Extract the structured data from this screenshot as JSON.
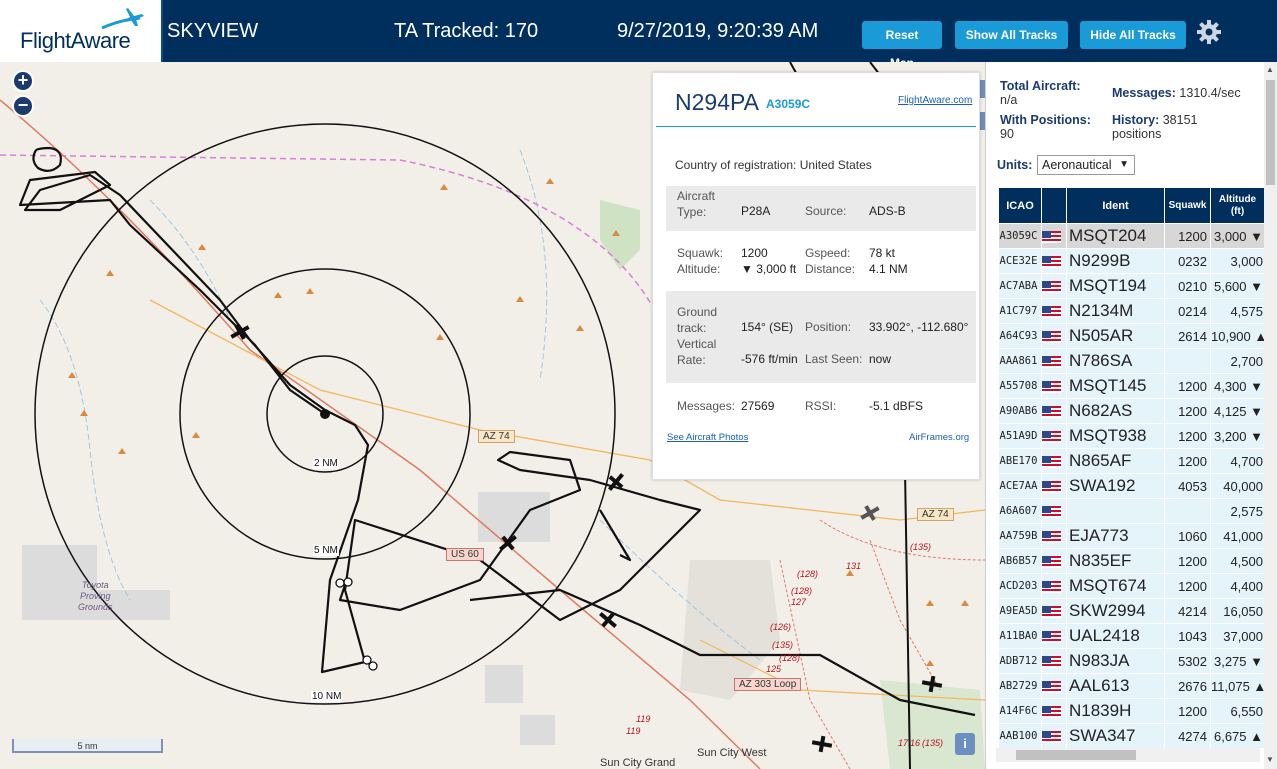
{
  "header": {
    "logo_text": "FlightAware",
    "app_name": "SKYVIEW",
    "tracked": "TA Tracked: 170",
    "datetime": "9/27/2019, 9:20:39 AM",
    "reset_label": "Reset Map",
    "show_label": "Show All Tracks",
    "hide_label": "Hide All Tracks"
  },
  "map": {
    "zoom_in": "+",
    "zoom_out": "−",
    "scale_label": "5 nm",
    "range_labels": [
      "2 NM",
      "5 NM",
      "10 NM"
    ],
    "road_labels": [
      "AZ 74",
      "AZ 74",
      "US 60",
      "AZ 303 Loop"
    ],
    "place_labels": [
      "Toyota",
      "Proving",
      "Grounds",
      "Sun City West",
      "Sun City Grand"
    ],
    "small_labels": [
      "(135)",
      "131",
      "(128)",
      "(128)",
      "127",
      "(126)",
      "125",
      "(135)",
      "119",
      "119",
      "17",
      "16",
      "(135)",
      "(128)"
    ],
    "info_label": "i"
  },
  "popup": {
    "registration": "N294PA",
    "icao": "A3059C",
    "fa_link": "FlightAware.com",
    "country_label": "Country of registration:",
    "country_value": "United States",
    "aircraft_type_label": "Aircraft\nType:",
    "aircraft_type_value": "P28A",
    "source_label": "Source:",
    "source_value": "ADS-B",
    "squawk_label": "Squawk:",
    "squawk_value": "1200",
    "altitude_label": "Altitude:",
    "altitude_value": "▼ 3,000 ft",
    "gspeed_label": "Gspeed:",
    "gspeed_value": "78 kt",
    "distance_label": "Distance:",
    "distance_value": "4.1 NM",
    "ground_track_label": "Ground\ntrack:",
    "ground_track_value": "154° (SE)",
    "position_label": "Position:",
    "position_value": "33.902°, -112.680°",
    "vertical_rate_label": "Vertical\nRate:",
    "vertical_rate_value": "-576 ft/min",
    "last_seen_label": "Last Seen:",
    "last_seen_value": "now",
    "messages_label": "Messages:",
    "messages_value": "27569",
    "rssi_label": "RSSI:",
    "rssi_value": "-5.1 dBFS",
    "photos_link": "See Aircraft Photos",
    "airframes_link": "AirFrames.org"
  },
  "sidebar": {
    "total_label": "Total Aircraft:",
    "total_value": "n/a",
    "positions_label": "With Positions:",
    "positions_value": "90",
    "messages_label": "Messages:",
    "messages_value": "1310.4/sec",
    "history_label": "History:",
    "history_value": "38151",
    "history_unit": "positions",
    "units_label": "Units:",
    "units_value": "Aeronautical",
    "columns": [
      "ICAO",
      "",
      "Ident",
      "Squawk",
      "Altitude (ft)"
    ],
    "rows": [
      {
        "icao": "A3059C",
        "ident": "MSQT204",
        "squawk": "1200",
        "alt": "3,000 ▼"
      },
      {
        "icao": "ACE32E",
        "ident": "N9299B",
        "squawk": "0232",
        "alt": "3,000"
      },
      {
        "icao": "AC7ABA",
        "ident": "MSQT194",
        "squawk": "0210",
        "alt": "5,600 ▼"
      },
      {
        "icao": "A1C797",
        "ident": "N2134M",
        "squawk": "0214",
        "alt": "4,575"
      },
      {
        "icao": "A64C93",
        "ident": "N505AR",
        "squawk": "2614",
        "alt": "10,900 ▲"
      },
      {
        "icao": "AAA861",
        "ident": "N786SA",
        "squawk": "",
        "alt": "2,700"
      },
      {
        "icao": "A55708",
        "ident": "MSQT145",
        "squawk": "1200",
        "alt": "4,300 ▼"
      },
      {
        "icao": "A90AB6",
        "ident": "N682AS",
        "squawk": "1200",
        "alt": "4,125 ▼"
      },
      {
        "icao": "A51A9D",
        "ident": "MSQT938",
        "squawk": "1200",
        "alt": "3,200 ▼"
      },
      {
        "icao": "ABE170",
        "ident": "N865AF",
        "squawk": "1200",
        "alt": "4,700"
      },
      {
        "icao": "ACE7AA",
        "ident": "SWA192",
        "squawk": "4053",
        "alt": "40,000"
      },
      {
        "icao": "A6A607",
        "ident": "",
        "squawk": "",
        "alt": "2,575"
      },
      {
        "icao": "AA759B",
        "ident": "EJA773",
        "squawk": "1060",
        "alt": "41,000"
      },
      {
        "icao": "AB6B57",
        "ident": "N835EF",
        "squawk": "1200",
        "alt": "4,500"
      },
      {
        "icao": "ACD203",
        "ident": "MSQT674",
        "squawk": "1200",
        "alt": "4,400"
      },
      {
        "icao": "A9EA5D",
        "ident": "SKW2994",
        "squawk": "4214",
        "alt": "16,050"
      },
      {
        "icao": "A11BA0",
        "ident": "UAL2418",
        "squawk": "1043",
        "alt": "37,000"
      },
      {
        "icao": "ADB712",
        "ident": "N983JA",
        "squawk": "5302",
        "alt": "3,275 ▼"
      },
      {
        "icao": "AB2729",
        "ident": "AAL613",
        "squawk": "2676",
        "alt": "11,075 ▲"
      },
      {
        "icao": "A14F6C",
        "ident": "N1839H",
        "squawk": "1200",
        "alt": "6,550"
      },
      {
        "icao": "AAB100",
        "ident": "SWA347",
        "squawk": "4274",
        "alt": "6,675 ▲"
      }
    ]
  },
  "colors": {
    "header_bg": "#002f5d",
    "button_bg": "#1a9ad6",
    "map_bg": "#f2efe9",
    "row_bg": "#e5f3fb",
    "selected_row_bg": "#d7d7d7"
  }
}
